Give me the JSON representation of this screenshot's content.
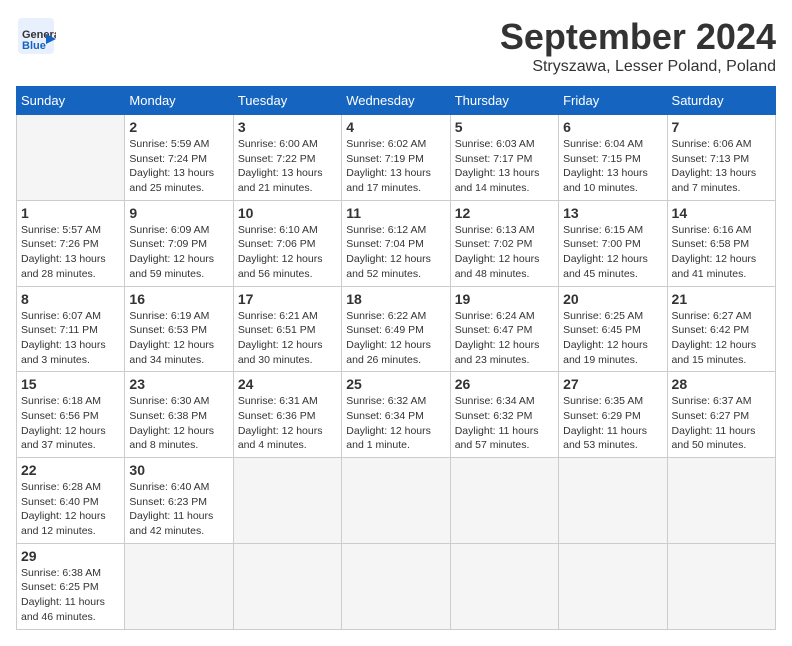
{
  "header": {
    "logo_general": "General",
    "logo_blue": "Blue",
    "month_title": "September 2024",
    "subtitle": "Stryszawa, Lesser Poland, Poland"
  },
  "calendar": {
    "days_of_week": [
      "Sunday",
      "Monday",
      "Tuesday",
      "Wednesday",
      "Thursday",
      "Friday",
      "Saturday"
    ],
    "weeks": [
      [
        null,
        {
          "day": "2",
          "line1": "Sunrise: 5:59 AM",
          "line2": "Sunset: 7:24 PM",
          "line3": "Daylight: 13 hours",
          "line4": "and 25 minutes."
        },
        {
          "day": "3",
          "line1": "Sunrise: 6:00 AM",
          "line2": "Sunset: 7:22 PM",
          "line3": "Daylight: 13 hours",
          "line4": "and 21 minutes."
        },
        {
          "day": "4",
          "line1": "Sunrise: 6:02 AM",
          "line2": "Sunset: 7:19 PM",
          "line3": "Daylight: 13 hours",
          "line4": "and 17 minutes."
        },
        {
          "day": "5",
          "line1": "Sunrise: 6:03 AM",
          "line2": "Sunset: 7:17 PM",
          "line3": "Daylight: 13 hours",
          "line4": "and 14 minutes."
        },
        {
          "day": "6",
          "line1": "Sunrise: 6:04 AM",
          "line2": "Sunset: 7:15 PM",
          "line3": "Daylight: 13 hours",
          "line4": "and 10 minutes."
        },
        {
          "day": "7",
          "line1": "Sunrise: 6:06 AM",
          "line2": "Sunset: 7:13 PM",
          "line3": "Daylight: 13 hours",
          "line4": "and 7 minutes."
        }
      ],
      [
        {
          "day": "1",
          "line1": "Sunrise: 5:57 AM",
          "line2": "Sunset: 7:26 PM",
          "line3": "Daylight: 13 hours",
          "line4": "and 28 minutes."
        },
        {
          "day": "9",
          "line1": "Sunrise: 6:09 AM",
          "line2": "Sunset: 7:09 PM",
          "line3": "Daylight: 12 hours",
          "line4": "and 59 minutes."
        },
        {
          "day": "10",
          "line1": "Sunrise: 6:10 AM",
          "line2": "Sunset: 7:06 PM",
          "line3": "Daylight: 12 hours",
          "line4": "and 56 minutes."
        },
        {
          "day": "11",
          "line1": "Sunrise: 6:12 AM",
          "line2": "Sunset: 7:04 PM",
          "line3": "Daylight: 12 hours",
          "line4": "and 52 minutes."
        },
        {
          "day": "12",
          "line1": "Sunrise: 6:13 AM",
          "line2": "Sunset: 7:02 PM",
          "line3": "Daylight: 12 hours",
          "line4": "and 48 minutes."
        },
        {
          "day": "13",
          "line1": "Sunrise: 6:15 AM",
          "line2": "Sunset: 7:00 PM",
          "line3": "Daylight: 12 hours",
          "line4": "and 45 minutes."
        },
        {
          "day": "14",
          "line1": "Sunrise: 6:16 AM",
          "line2": "Sunset: 6:58 PM",
          "line3": "Daylight: 12 hours",
          "line4": "and 41 minutes."
        }
      ],
      [
        {
          "day": "8",
          "line1": "Sunrise: 6:07 AM",
          "line2": "Sunset: 7:11 PM",
          "line3": "Daylight: 13 hours",
          "line4": "and 3 minutes."
        },
        {
          "day": "16",
          "line1": "Sunrise: 6:19 AM",
          "line2": "Sunset: 6:53 PM",
          "line3": "Daylight: 12 hours",
          "line4": "and 34 minutes."
        },
        {
          "day": "17",
          "line1": "Sunrise: 6:21 AM",
          "line2": "Sunset: 6:51 PM",
          "line3": "Daylight: 12 hours",
          "line4": "and 30 minutes."
        },
        {
          "day": "18",
          "line1": "Sunrise: 6:22 AM",
          "line2": "Sunset: 6:49 PM",
          "line3": "Daylight: 12 hours",
          "line4": "and 26 minutes."
        },
        {
          "day": "19",
          "line1": "Sunrise: 6:24 AM",
          "line2": "Sunset: 6:47 PM",
          "line3": "Daylight: 12 hours",
          "line4": "and 23 minutes."
        },
        {
          "day": "20",
          "line1": "Sunrise: 6:25 AM",
          "line2": "Sunset: 6:45 PM",
          "line3": "Daylight: 12 hours",
          "line4": "and 19 minutes."
        },
        {
          "day": "21",
          "line1": "Sunrise: 6:27 AM",
          "line2": "Sunset: 6:42 PM",
          "line3": "Daylight: 12 hours",
          "line4": "and 15 minutes."
        }
      ],
      [
        {
          "day": "15",
          "line1": "Sunrise: 6:18 AM",
          "line2": "Sunset: 6:56 PM",
          "line3": "Daylight: 12 hours",
          "line4": "and 37 minutes."
        },
        {
          "day": "23",
          "line1": "Sunrise: 6:30 AM",
          "line2": "Sunset: 6:38 PM",
          "line3": "Daylight: 12 hours",
          "line4": "and 8 minutes."
        },
        {
          "day": "24",
          "line1": "Sunrise: 6:31 AM",
          "line2": "Sunset: 6:36 PM",
          "line3": "Daylight: 12 hours",
          "line4": "and 4 minutes."
        },
        {
          "day": "25",
          "line1": "Sunrise: 6:32 AM",
          "line2": "Sunset: 6:34 PM",
          "line3": "Daylight: 12 hours",
          "line4": "and 1 minute."
        },
        {
          "day": "26",
          "line1": "Sunrise: 6:34 AM",
          "line2": "Sunset: 6:32 PM",
          "line3": "Daylight: 11 hours",
          "line4": "and 57 minutes."
        },
        {
          "day": "27",
          "line1": "Sunrise: 6:35 AM",
          "line2": "Sunset: 6:29 PM",
          "line3": "Daylight: 11 hours",
          "line4": "and 53 minutes."
        },
        {
          "day": "28",
          "line1": "Sunrise: 6:37 AM",
          "line2": "Sunset: 6:27 PM",
          "line3": "Daylight: 11 hours",
          "line4": "and 50 minutes."
        }
      ],
      [
        {
          "day": "22",
          "line1": "Sunrise: 6:28 AM",
          "line2": "Sunset: 6:40 PM",
          "line3": "Daylight: 12 hours",
          "line4": "and 12 minutes."
        },
        {
          "day": "30",
          "line1": "Sunrise: 6:40 AM",
          "line2": "Sunset: 6:23 PM",
          "line3": "Daylight: 11 hours",
          "line4": "and 42 minutes."
        },
        null,
        null,
        null,
        null,
        null
      ],
      [
        {
          "day": "29",
          "line1": "Sunrise: 6:38 AM",
          "line2": "Sunset: 6:25 PM",
          "line3": "Daylight: 11 hours",
          "line4": "and 46 minutes."
        },
        null,
        null,
        null,
        null,
        null,
        null
      ]
    ]
  }
}
